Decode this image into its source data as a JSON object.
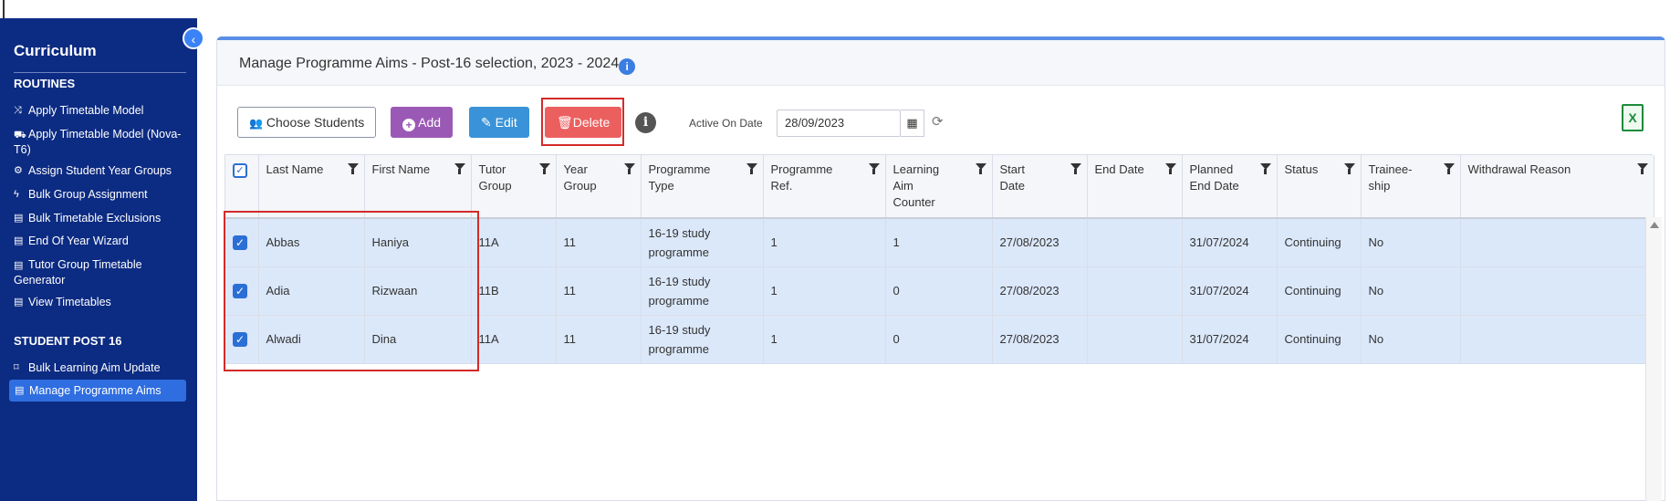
{
  "sidebar": {
    "title": "Curriculum",
    "sections": [
      {
        "label": "ROUTINES",
        "items": [
          {
            "icon": "shuffle-icon",
            "glyph": "⤨",
            "label": "Apply Timetable Model"
          },
          {
            "icon": "car-icon",
            "glyph": "⛟",
            "label": "Apply Timetable Model (Nova-T6)"
          },
          {
            "icon": "palette-icon",
            "glyph": "⚙",
            "label": "Assign Student Year Groups"
          },
          {
            "icon": "bolt-icon",
            "glyph": "ϟ",
            "label": "Bulk Group Assignment"
          },
          {
            "icon": "list-icon",
            "glyph": "▤",
            "label": "Bulk Timetable Exclusions"
          },
          {
            "icon": "list-icon",
            "glyph": "▤",
            "label": "End Of Year Wizard"
          },
          {
            "icon": "list-icon",
            "glyph": "▤",
            "label": "Tutor Group Timetable Generator"
          },
          {
            "icon": "list-icon",
            "glyph": "▤",
            "label": "View Timetables"
          }
        ]
      },
      {
        "label": "STUDENT POST 16",
        "items": [
          {
            "icon": "bookmark-icon",
            "glyph": "⌑",
            "label": "Bulk Learning Aim Update"
          },
          {
            "icon": "list-icon",
            "glyph": "▤",
            "label": "Manage Programme Aims",
            "active": true
          }
        ]
      }
    ]
  },
  "collapse_glyph": "‹",
  "panel": {
    "title": "Manage Programme Aims - Post-16 selection, 2023 - 2024",
    "info_glyph": "i"
  },
  "toolbar": {
    "choose_students": "Choose Students",
    "add": "Add",
    "edit": "Edit",
    "delete": "Delete",
    "info_glyph": "i",
    "active_on_date_label": "Active On Date",
    "active_on_date_value": "28/09/2023",
    "calendar_glyph": "▦",
    "refresh_glyph": "⟳",
    "excel_glyph": "X"
  },
  "table": {
    "columns": [
      "Last Name",
      "First Name",
      "Tutor Group",
      "Year Group",
      "Programme Type",
      "Programme Ref.",
      "Learning Aim Counter",
      "Start Date",
      "End Date",
      "Planned End Date",
      "Status",
      "Trainee-ship",
      "Withdrawal Reason"
    ],
    "rows": [
      [
        "Abbas",
        "Haniya",
        "11A",
        "11",
        "16-19 study programme",
        "1",
        "1",
        "27/08/2023",
        "",
        "31/07/2024",
        "Continuing",
        "No",
        ""
      ],
      [
        "Adia",
        "Rizwaan",
        "11B",
        "11",
        "16-19 study programme",
        "1",
        "0",
        "27/08/2023",
        "",
        "31/07/2024",
        "Continuing",
        "No",
        ""
      ],
      [
        "Alwadi",
        "Dina",
        "11A",
        "11",
        "16-19 study programme",
        "1",
        "0",
        "27/08/2023",
        "",
        "31/07/2024",
        "Continuing",
        "No",
        ""
      ]
    ],
    "check_glyph": "✓"
  }
}
